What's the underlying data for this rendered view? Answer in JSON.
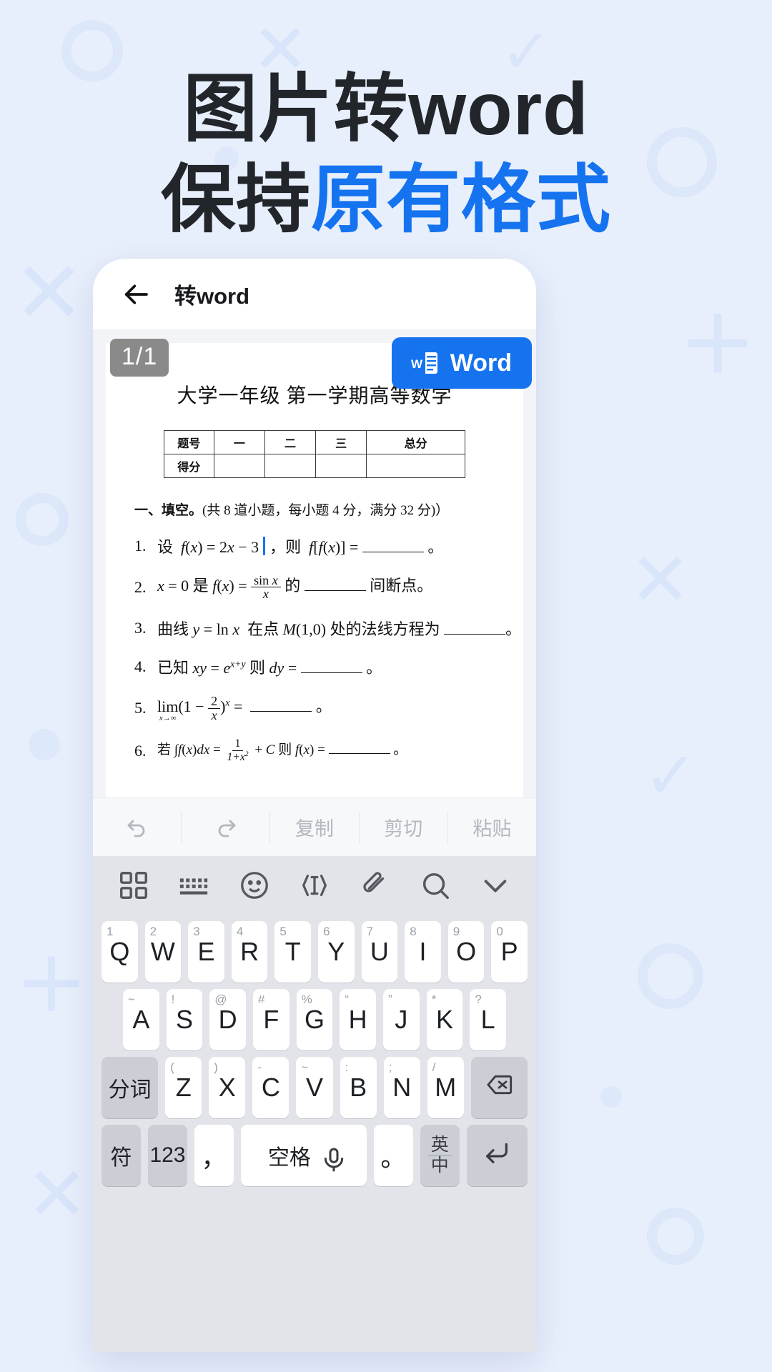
{
  "theme": {
    "bg": "#e8effc",
    "accent": "#1573f0",
    "text_dark": "#22262b"
  },
  "headline": {
    "line1": "图片转word",
    "line2_plain": "保持",
    "line2_accent": "原有格式"
  },
  "phone": {
    "header": {
      "back_icon": "arrow-left-icon",
      "title": "转word"
    },
    "document": {
      "page_badge": "1/1",
      "word_button": {
        "label": "Word",
        "icon": "word-file-icon"
      },
      "title": "大学一年级 第一学期高等数学",
      "score_table": {
        "rows": [
          {
            "label": "题号",
            "cells": [
              "一",
              "二",
              "三",
              "总分"
            ]
          },
          {
            "label": "得分",
            "cells": [
              "",
              "",
              "",
              ""
            ]
          }
        ]
      },
      "section_heading_bold": "一、填空。",
      "section_heading_rest": "(共 8 道小题，每小题 4 分，满分 32 分)）",
      "questions": [
        {
          "n": "1.",
          "text": "设 f(x) = 2x − 3 ，则 f[f(x)] = ________ 。",
          "has_caret": true
        },
        {
          "n": "2.",
          "text": "x = 0 是 f(x) = sin x / x 的 ________ 间断点。",
          "has_caret": false
        },
        {
          "n": "3.",
          "text": "曲线 y = ln x 在点 M(1,0) 处的法线方程为 ________ 。",
          "has_caret": false
        },
        {
          "n": "4.",
          "text": "已知 xy = e^(x+y) 则 dy = ________ 。",
          "has_caret": false
        },
        {
          "n": "5.",
          "text": "lim(x→∞)(1 − 2/x)^x = ________ 。",
          "has_caret": false
        },
        {
          "n": "6.",
          "text": "若 ∫f(x)dx = 1/(1+x²) + C 则 f(x) = ________ 。",
          "has_caret": false
        }
      ]
    },
    "edit_toolbar": [
      {
        "name": "undo-button",
        "type": "icon",
        "icon": "undo-icon",
        "label": ""
      },
      {
        "name": "redo-button",
        "type": "icon",
        "icon": "redo-icon",
        "label": ""
      },
      {
        "name": "copy-button",
        "type": "text",
        "icon": "",
        "label": "复制"
      },
      {
        "name": "cut-button",
        "type": "text",
        "icon": "",
        "label": "剪切"
      },
      {
        "name": "paste-button",
        "type": "text",
        "icon": "",
        "label": "粘贴"
      }
    ],
    "keyboard": {
      "toolbar_icons": [
        "grid-apps-icon",
        "keyboard-icon",
        "emoji-icon",
        "text-cursor-icon",
        "clip-icon",
        "search-icon",
        "chevron-down-icon"
      ],
      "row1": [
        {
          "alt": "1",
          "key": "Q"
        },
        {
          "alt": "2",
          "key": "W"
        },
        {
          "alt": "3",
          "key": "E"
        },
        {
          "alt": "4",
          "key": "R"
        },
        {
          "alt": "5",
          "key": "T"
        },
        {
          "alt": "6",
          "key": "Y"
        },
        {
          "alt": "7",
          "key": "U"
        },
        {
          "alt": "8",
          "key": "I"
        },
        {
          "alt": "9",
          "key": "O"
        },
        {
          "alt": "0",
          "key": "P"
        }
      ],
      "row2": [
        {
          "alt": "~",
          "key": "A"
        },
        {
          "alt": "!",
          "key": "S"
        },
        {
          "alt": "@",
          "key": "D"
        },
        {
          "alt": "#",
          "key": "F"
        },
        {
          "alt": "%",
          "key": "G"
        },
        {
          "alt": "“",
          "key": "H"
        },
        {
          "alt": "”",
          "key": "J"
        },
        {
          "alt": "*",
          "key": "K"
        },
        {
          "alt": "?",
          "key": "L"
        }
      ],
      "row3_left": "分词",
      "row3": [
        {
          "alt": "(",
          "key": "Z"
        },
        {
          "alt": ")",
          "key": "X"
        },
        {
          "alt": "-",
          "key": "C"
        },
        {
          "alt": "~",
          "key": "V"
        },
        {
          "alt": ":",
          "key": "B"
        },
        {
          "alt": ";",
          "key": "N"
        },
        {
          "alt": "/",
          "key": "M"
        }
      ],
      "row3_right_icon": "backspace-icon",
      "row4": {
        "symbol": "符",
        "numbers": "123",
        "comma": "，",
        "space": "空格",
        "space_icon": "microphone-icon",
        "period": "。",
        "lang_top": "英",
        "lang_bottom": "中",
        "enter_icon": "enter-icon"
      }
    }
  }
}
